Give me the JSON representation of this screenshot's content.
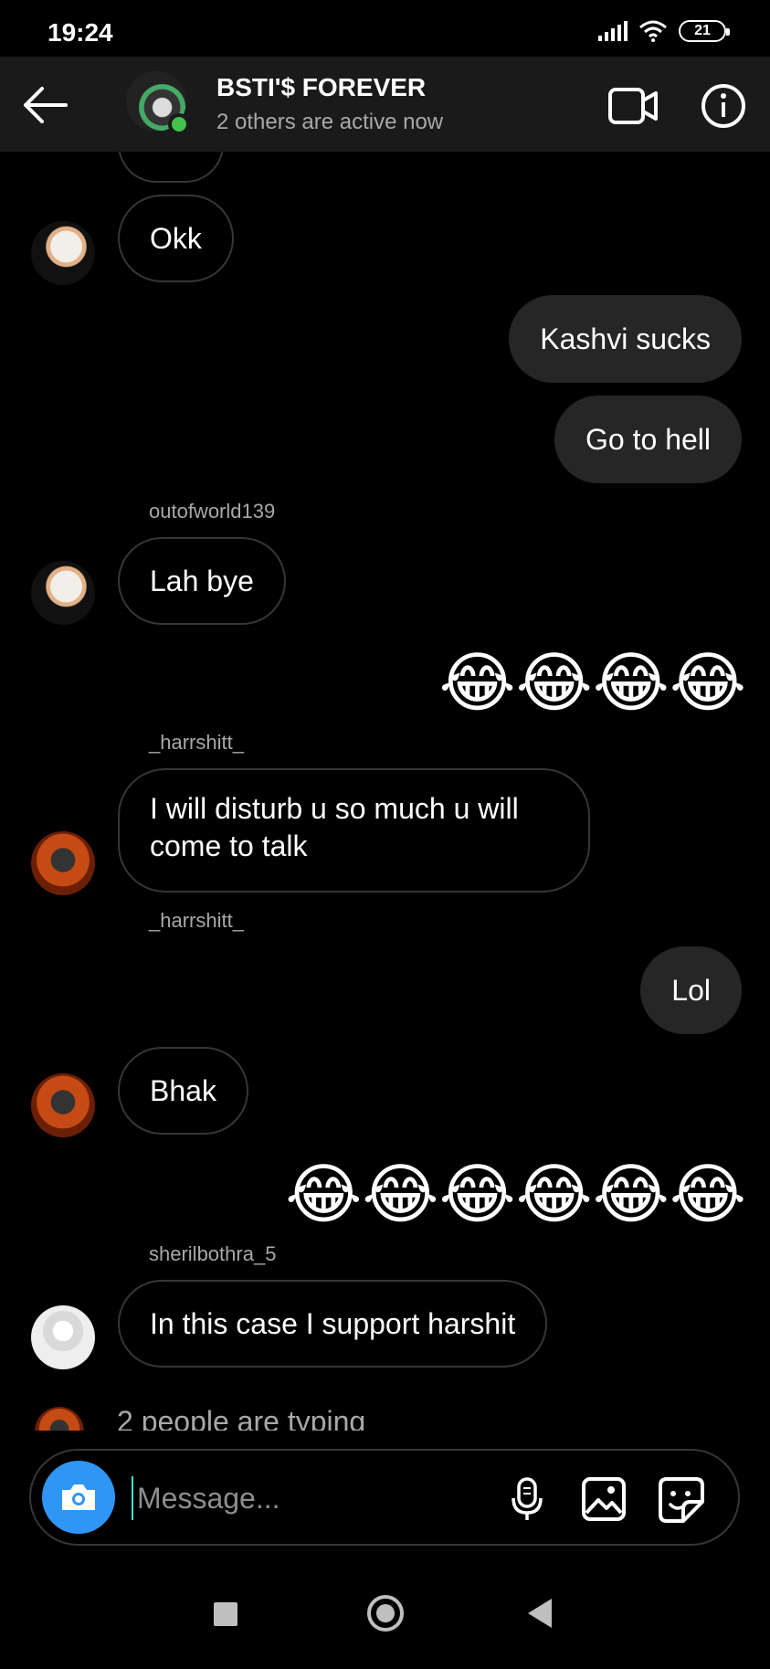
{
  "status_bar": {
    "time": "19:24",
    "battery": "21",
    "icons": [
      "signal-icon",
      "wifi-icon",
      "battery-icon"
    ]
  },
  "header": {
    "title": "BSTI'$ FOREVER",
    "subtitle": "2 others are active now",
    "back_icon": "arrow-left-icon",
    "video_icon": "video-camera-icon",
    "info_icon": "info-icon"
  },
  "messages": [
    {
      "direction": "in",
      "text": "Okk"
    },
    {
      "direction": "out",
      "text": "Kashvi sucks"
    },
    {
      "direction": "out",
      "text": "Go to hell"
    },
    {
      "direction": "in",
      "sender": "outofworld139",
      "text": "Lah bye"
    },
    {
      "direction": "out",
      "emoji": "😂😂😂😂"
    },
    {
      "direction": "in",
      "sender": "_harrshitt_",
      "text_line1": "I will disturb u so much u will",
      "text_line2": "come to talk"
    },
    {
      "direction": "out",
      "sender_above": "_harrshitt_",
      "text": "Lol"
    },
    {
      "direction": "in",
      "text": "Bhak"
    },
    {
      "direction": "out",
      "emoji": "😂😂😂😂😂😂"
    },
    {
      "direction": "in",
      "sender": "sherilbothra_5",
      "text": "In this case I support harshit"
    }
  ],
  "typing": "2 people are typing",
  "composer": {
    "placeholder": "Message...",
    "camera_icon": "camera-icon",
    "mic_icon": "microphone-icon",
    "gallery_icon": "image-icon",
    "sticker_icon": "sticker-icon"
  },
  "colors": {
    "background": "#000000",
    "header_bg": "#1a1a1a",
    "bubble_out": "#262626",
    "bubble_in_border": "#363636",
    "camera_button": "#2f96f5",
    "online_dot": "#44c14a",
    "secondary_text": "#a8a8a8"
  }
}
